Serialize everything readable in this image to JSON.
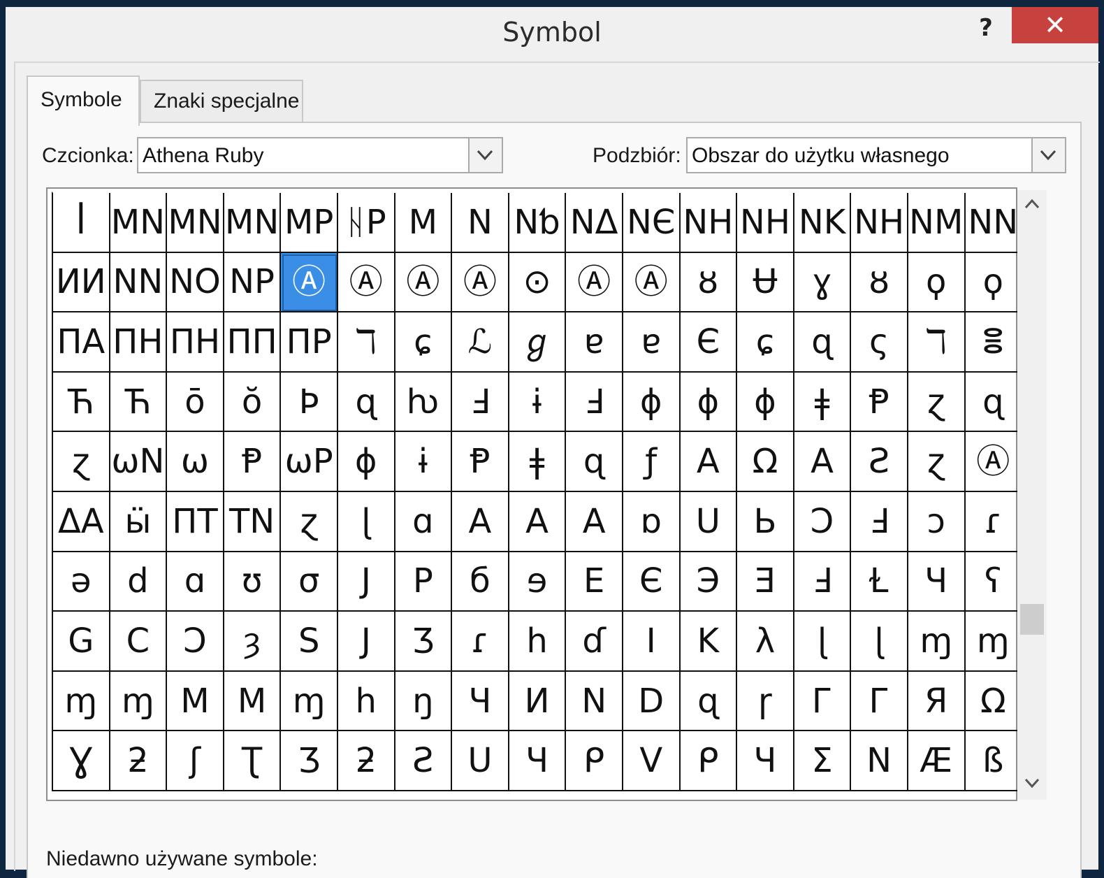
{
  "window": {
    "title": "Symbol",
    "help_label": "?",
    "close_label": "✕"
  },
  "tabs": [
    {
      "label": "Symbole",
      "active": true
    },
    {
      "label": "Znaki specjalne",
      "active": false
    }
  ],
  "font_field": {
    "label": "Czcionka:",
    "value": "Athena Ruby"
  },
  "subset_field": {
    "label": "Podzbiór:",
    "value": "Obszar do użytku własnego"
  },
  "grid": {
    "selected_index": 21,
    "cells": [
      "ꟾ",
      "MN",
      "MN",
      "MN",
      "MP",
      "ᚺP",
      "M",
      "N",
      "Nƅ",
      "NΔ",
      "NЄ",
      "NH",
      "NH",
      "NK",
      "NH",
      "NM",
      "NN",
      "ИИ",
      "NN",
      "NO",
      "NP",
      "Ⓐ",
      "Ⓐ",
      "Ⓐ",
      "Ⓐ",
      "⊙",
      "Ⓐ",
      "Ⓐ",
      "ȣ",
      "Ʉ",
      "ɣ",
      "ȣ",
      "ϙ",
      "ϙ",
      "ΠΑ",
      "ΠΗ",
      "ΠΗ",
      "ΠΠ",
      "ΠΡ",
      "ℸ",
      "ɕ",
      "ℒ",
      "ℊ",
      "ɐ",
      "ɐ",
      "Є",
      "ɕ",
      "ɋ",
      "ς",
      "ℸ",
      "ⴻ",
      "Ћ",
      "Ћ",
      "ō",
      "ŏ",
      "Þ",
      "ɋ",
      "ƕ",
      "Ⅎ",
      "ɨ",
      "Ⅎ",
      "ɸ",
      "ɸ",
      "ɸ",
      "ǂ",
      "Ᵽ",
      "ɀ",
      "ɋ",
      "ɀ",
      "ωN",
      "ω",
      "Ᵽ",
      "ωP",
      "ɸ",
      "ɨ",
      "Ᵽ",
      "ǂ",
      "ɋ",
      "ƒ",
      "Α",
      "Ω",
      "Α",
      "Ƨ",
      "ɀ",
      "Ⓐ",
      "ΔΑ",
      "ӹ",
      "ΠΤ",
      "ΤΝ",
      "ɀ",
      "ɭ",
      "ɑ",
      "Α",
      "Α",
      "Α",
      "ɒ",
      "Ս",
      "Ь",
      "Ↄ",
      "Ⅎ",
      "ↄ",
      "ɾ",
      "ə",
      "d",
      "ɑ",
      "ʊ",
      "σ",
      "J",
      "P",
      "б",
      "ɘ",
      "E",
      "Є",
      "Э",
      "Ǝ",
      "Ⅎ",
      "Ɫ",
      "Ч",
      "ʕ",
      "G",
      "C",
      "Ɔ",
      "ȝ",
      "S",
      "J",
      "Ʒ",
      "ɾ",
      "h",
      "ɗ",
      "I",
      "K",
      "λ",
      "ɭ",
      "ɭ",
      "ɱ",
      "ɱ",
      "ɱ",
      "ɱ",
      "Μ",
      "Μ",
      "ɱ",
      "h",
      "ŋ",
      "Ч",
      "И",
      "N",
      "D",
      "ɋ",
      "ɼ",
      "Г",
      "Г",
      "Я",
      "Ω",
      "Ɣ",
      "ƻ",
      "ʃ",
      "Ʈ",
      "Ʒ",
      "ƻ",
      "Ƨ",
      "Ս",
      "Ч",
      "ᑭ",
      "V",
      "ᑭ",
      "Ч",
      "Σ",
      "Ν",
      "Æ",
      "ß"
    ]
  },
  "recent": {
    "label": "Niedawno używane symbole:"
  }
}
